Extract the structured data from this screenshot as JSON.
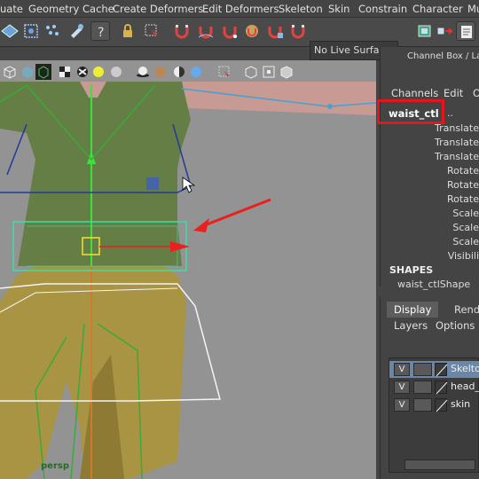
{
  "menubar": {
    "items": [
      "uate",
      "Geometry Cache",
      "Create Deformers",
      "Edit Deformers",
      "Skeleton",
      "Skin",
      "Constrain",
      "Character",
      "Mu"
    ]
  },
  "shelf": {
    "live_surface": "No Live Surface"
  },
  "viewport": {
    "camera_label": "persp"
  },
  "channel_box": {
    "title": "Channel Box / Lay",
    "tabs": [
      "Channels",
      "Edit",
      "O"
    ],
    "object_name": "waist_ctl",
    "object_dots": "..",
    "attributes": [
      "Translate",
      "Translate",
      "Translate",
      "Rotate",
      "Rotate",
      "Rotate",
      "Scale",
      "Scale",
      "Scale",
      "Visibili"
    ],
    "shapes_header": "SHAPES",
    "shape_name": "waist_ctlShape"
  },
  "layer_editor": {
    "tabs": [
      "Display",
      "Rende"
    ],
    "menus": [
      "Layers",
      "Options"
    ],
    "layers": [
      {
        "visible": "V",
        "name": "Skelton",
        "color": "#5a8fc8",
        "selected": true
      },
      {
        "visible": "V",
        "name": "head_c",
        "color": "#3a3a3a",
        "selected": false
      },
      {
        "visible": "V",
        "name": "skin",
        "color": "#3a3a3a",
        "selected": false
      }
    ]
  },
  "colors": {
    "highlight_red": "#e8141b",
    "selection_blue": "#5a8fc8",
    "viewport_bg": "#939393"
  }
}
